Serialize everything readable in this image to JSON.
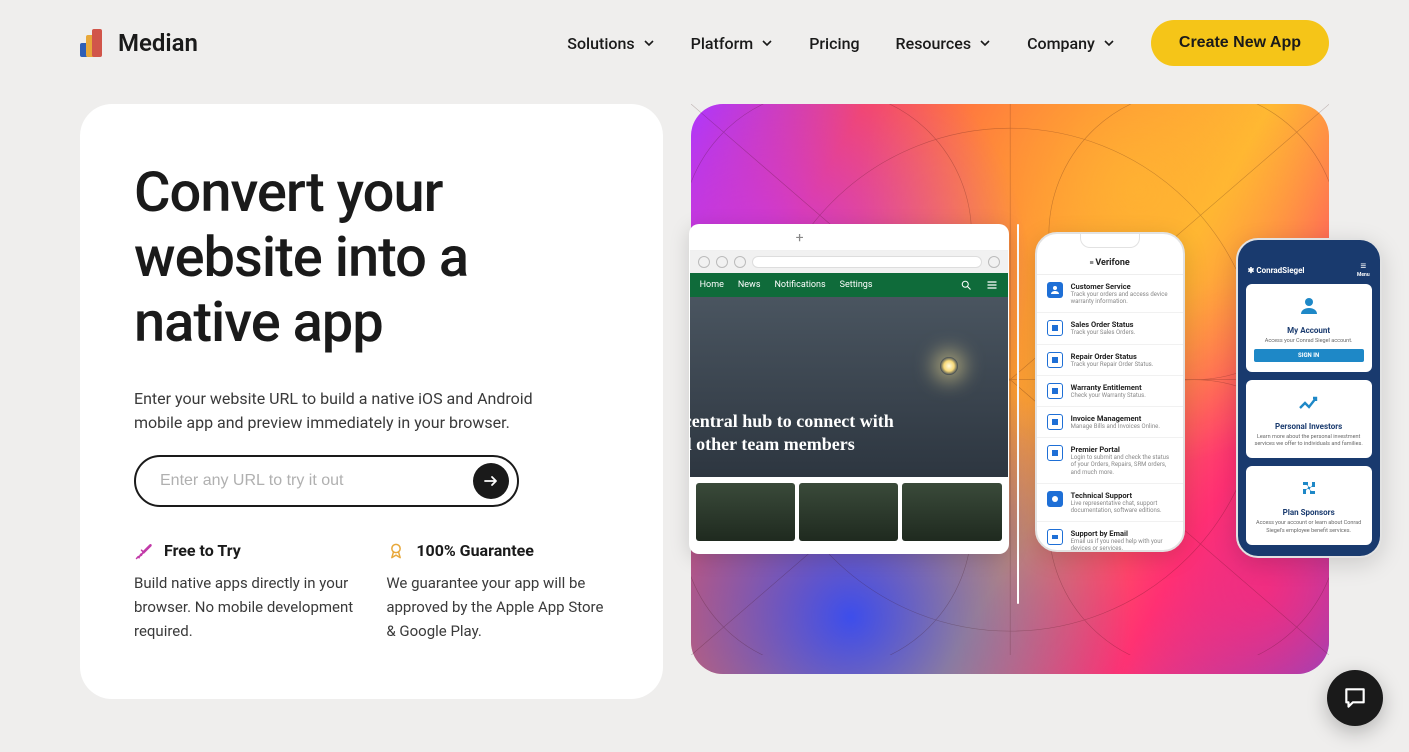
{
  "brand": {
    "name": "Median"
  },
  "nav": {
    "solutions": "Solutions",
    "platform": "Platform",
    "pricing": "Pricing",
    "resources": "Resources",
    "company": "Company"
  },
  "cta": {
    "label": "Create New App"
  },
  "hero": {
    "title": "Convert your website into a native app",
    "sub": "Enter your website URL to build a native iOS and Android mobile app and preview immediately in your browser.",
    "input_placeholder": "Enter any URL to try it out"
  },
  "features": {
    "free": {
      "title": "Free to Try",
      "body": "Build native apps directly in your browser. No mobile development required."
    },
    "guarantee": {
      "title": "100% Guarantee",
      "body": "We guarantee your app will be approved by the Apple App Store & Google Play."
    }
  },
  "mockup": {
    "browser": {
      "nav": {
        "home": "Home",
        "news": "News",
        "notifications": "Notifications",
        "settings": "Settings"
      },
      "hero_line1": "r central hub to connect with",
      "hero_line2": "nd other team members"
    },
    "phone1": {
      "brand": "Verifone",
      "rows": [
        {
          "title": "Customer Service",
          "sub": "Track your orders and access device warranty information."
        },
        {
          "title": "Sales Order Status",
          "sub": "Track your Sales Orders."
        },
        {
          "title": "Repair Order Status",
          "sub": "Track your Repair Order Status."
        },
        {
          "title": "Warranty Entitlement",
          "sub": "Check your Warranty Status."
        },
        {
          "title": "Invoice Management",
          "sub": "Manage Bills and Invoices Online."
        },
        {
          "title": "Premier Portal",
          "sub": "Login to submit and check the status of your Orders, Repairs, SRM orders, and much more."
        },
        {
          "title": "Technical Support",
          "sub": "Live representative chat, support documentation, software editions."
        },
        {
          "title": "Support by Email",
          "sub": "Email us if you need help with your devices or services."
        }
      ]
    },
    "phone2": {
      "brand": "ConradSiegel",
      "menu": "Menu",
      "cards": [
        {
          "title": "My Account",
          "sub": "Access your Conrad Siegel account.",
          "button": "SIGN IN"
        },
        {
          "title": "Personal Investors",
          "sub": "Learn more about the personal investment services we offer to individuals and families."
        },
        {
          "title": "Plan Sponsors",
          "sub": "Access your account or learn about Conrad Siegel's employee benefit services."
        }
      ]
    }
  }
}
